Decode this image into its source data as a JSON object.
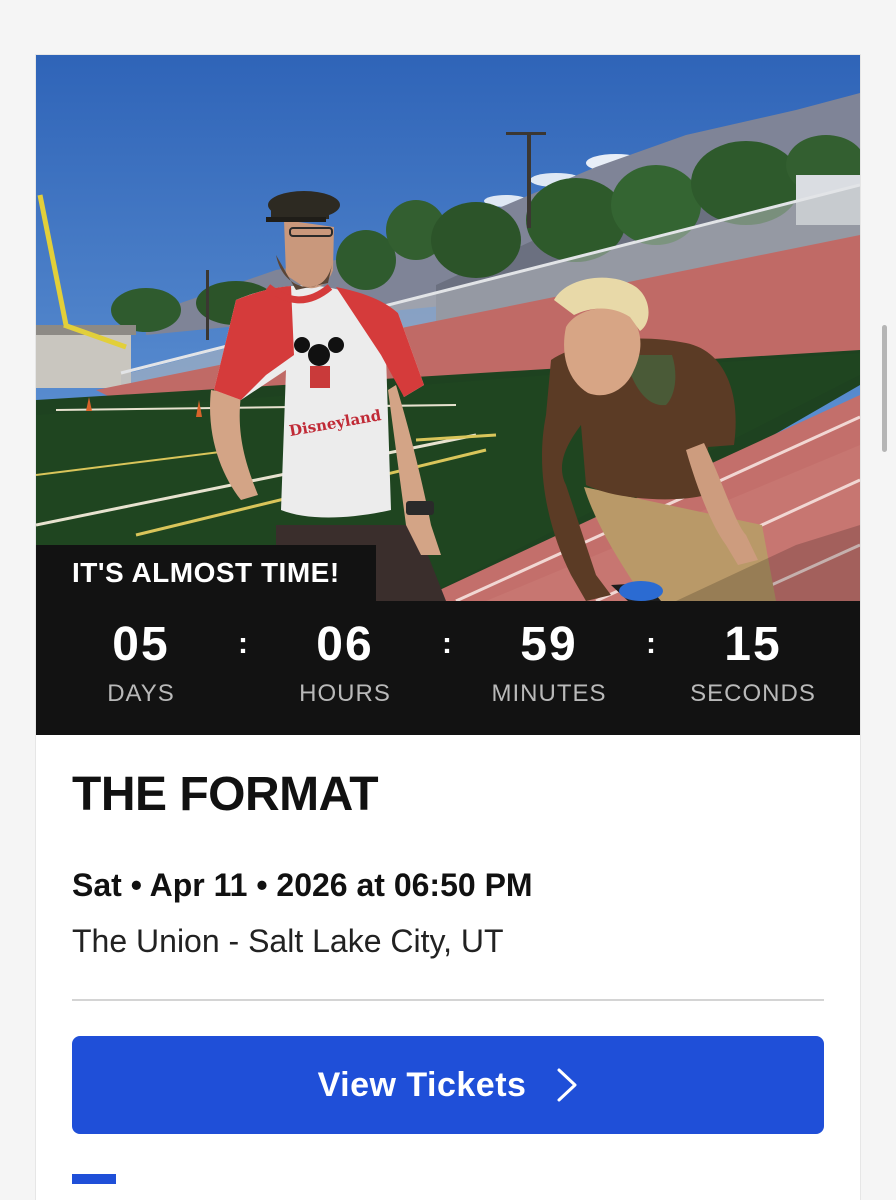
{
  "event": {
    "image_alt": "Two band members on a sports field track",
    "tagline": "IT'S ALMOST TIME!",
    "countdown": {
      "days": "05",
      "days_label": "DAYS",
      "hours": "06",
      "hours_label": "HOURS",
      "minutes": "59",
      "minutes_label": "MINUTES",
      "seconds": "15",
      "seconds_label": "SECONDS",
      "separator": ":"
    },
    "title": "THE FORMAT",
    "datetime": "Sat • Apr 11 • 2026 at 06:50 PM",
    "venue": "The Union - Salt Lake City, UT",
    "shirt_text": "Disneyland"
  },
  "actions": {
    "view_tickets_label": "View Tickets",
    "chevron_icon": "chevron-right-icon"
  },
  "colors": {
    "accent": "#1f4fd8",
    "countdown_bg": "#121212",
    "countdown_label": "#b9b9b9"
  }
}
